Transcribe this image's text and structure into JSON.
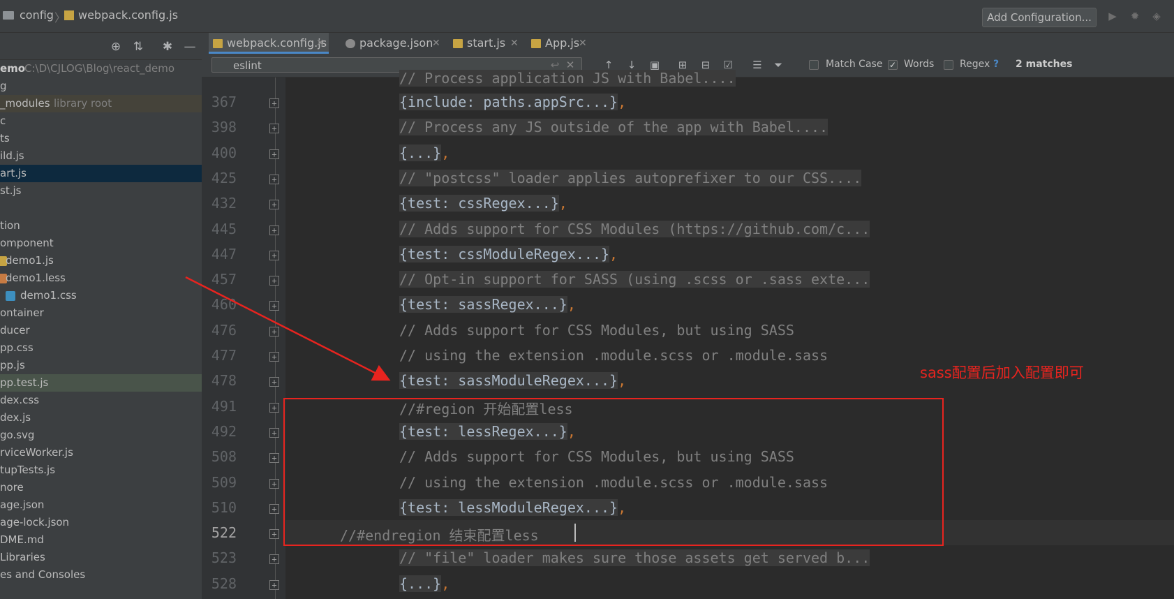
{
  "navbar": {
    "folder": "config",
    "file": "webpack.config.js",
    "add_config": "Add Configuration..."
  },
  "tree": {
    "items": [
      {
        "label": "emo",
        "hint": "C:\\D\\CJLOG\\Blog\\react_demo"
      },
      {
        "label": "g"
      },
      {
        "label": "_modules",
        "hint": "library root"
      },
      {
        "label": "c"
      },
      {
        "label": "ts"
      },
      {
        "label": "ild.js"
      },
      {
        "label": "art.js"
      },
      {
        "label": "st.js"
      },
      {
        "label": ""
      },
      {
        "label": "tion"
      },
      {
        "label": "omponent"
      },
      {
        "label": "demo1.js"
      },
      {
        "label": "demo1.less"
      },
      {
        "label": "demo1.css"
      },
      {
        "label": "ontainer"
      },
      {
        "label": "ducer"
      },
      {
        "label": "pp.css"
      },
      {
        "label": "pp.js"
      },
      {
        "label": "pp.test.js"
      },
      {
        "label": "dex.css"
      },
      {
        "label": "dex.js"
      },
      {
        "label": "go.svg"
      },
      {
        "label": "rviceWorker.js"
      },
      {
        "label": "tupTests.js"
      },
      {
        "label": "nore"
      },
      {
        "label": "age.json"
      },
      {
        "label": "age-lock.json"
      },
      {
        "label": "DME.md"
      },
      {
        "label": "Libraries"
      },
      {
        "label": "es and Consoles"
      }
    ]
  },
  "tabs": [
    {
      "label": "webpack.config.js"
    },
    {
      "label": "package.json"
    },
    {
      "label": "start.js"
    },
    {
      "label": "App.js"
    }
  ],
  "search": {
    "value": "eslint",
    "match_case": "Match Case",
    "words": "Words",
    "regex": "Regex",
    "help": "?",
    "matches": "2 matches"
  },
  "code": {
    "top_partial": "// Process application JS with Babel....",
    "lines": [
      {
        "n": "367",
        "text": "{include: paths.appSrc...}",
        "comma": true,
        "cmt": false
      },
      {
        "n": "398",
        "text": "// Process any JS outside of the app with Babel....",
        "cmt": true
      },
      {
        "n": "400",
        "text": "{...}",
        "comma": true,
        "cmt": false
      },
      {
        "n": "425",
        "text": "// \"postcss\" loader applies autoprefixer to our CSS....",
        "cmt": true
      },
      {
        "n": "432",
        "text": "{test: cssRegex...}",
        "comma": true,
        "cmt": false
      },
      {
        "n": "445",
        "text": "// Adds support for CSS Modules (https://github.com/c...",
        "cmt": true
      },
      {
        "n": "447",
        "text": "{test: cssModuleRegex...}",
        "comma": true,
        "cmt": false
      },
      {
        "n": "457",
        "text": "// Opt-in support for SASS (using .scss or .sass exte...",
        "cmt": true
      },
      {
        "n": "460",
        "text": "{test: sassRegex...}",
        "comma": true,
        "cmt": false
      },
      {
        "n": "476",
        "text": "// Adds support for CSS Modules, but using SASS",
        "cmt": true,
        "plain": true
      },
      {
        "n": "477",
        "text": "// using the extension .module.scss or .module.sass",
        "cmt": true,
        "plain": true
      },
      {
        "n": "478",
        "text": "{test: sassModuleRegex...}",
        "comma": true,
        "cmt": false
      },
      {
        "n": "491",
        "text": "//#region 开始配置less",
        "cmt": true,
        "plain": true
      },
      {
        "n": "492",
        "text": "{test: lessRegex...}",
        "comma": true,
        "cmt": false
      },
      {
        "n": "508",
        "text": "// Adds support for CSS Modules, but using SASS",
        "cmt": true,
        "plain": true
      },
      {
        "n": "509",
        "text": "// using the extension .module.scss or .module.sass",
        "cmt": true,
        "plain": true
      },
      {
        "n": "510",
        "text": "{test: lessModuleRegex...}",
        "comma": true,
        "cmt": false
      },
      {
        "n": "522",
        "text": "//#endregion 结束配置less",
        "cmt": true,
        "plain": true,
        "outdent": true
      },
      {
        "n": "523",
        "text": "// \"file\" loader makes sure those assets get served b...",
        "cmt": true
      },
      {
        "n": "528",
        "text": "{...}",
        "comma": true,
        "cmt": false
      }
    ]
  },
  "annotation": {
    "text": "sass配置后加入配置即可",
    "color": "#e8241f"
  }
}
